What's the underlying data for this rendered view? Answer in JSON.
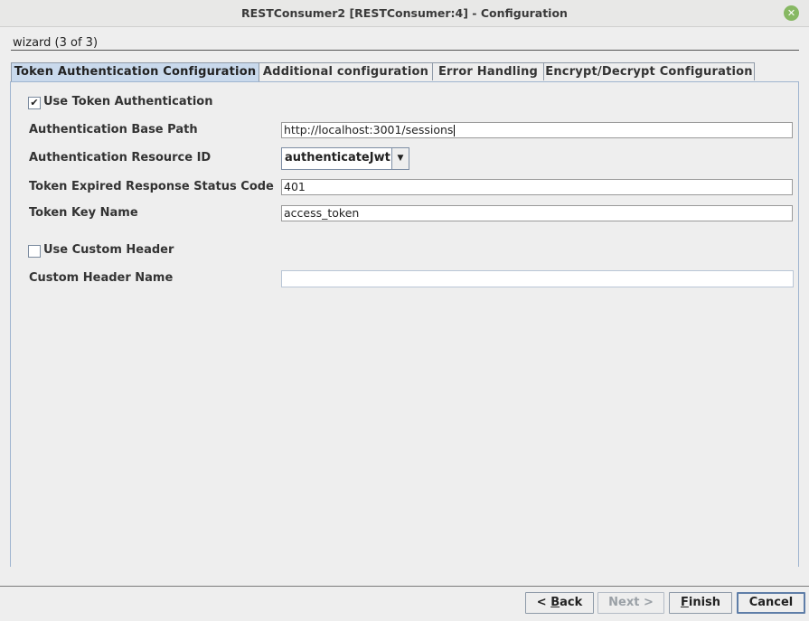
{
  "window": {
    "title": "RESTConsumer2 [RESTConsumer:4] - Configuration"
  },
  "wizard": {
    "label": "wizard (3 of 3)"
  },
  "tabs": [
    {
      "label": "Token Authentication Configuration",
      "active": true
    },
    {
      "label": "Additional configuration",
      "active": false
    },
    {
      "label": "Error Handling",
      "active": false
    },
    {
      "label": "Encrypt/Decrypt Configuration",
      "active": false
    }
  ],
  "form": {
    "use_token_auth": {
      "label": "Use Token Authentication",
      "checked": true,
      "mark": "✔"
    },
    "auth_base_path": {
      "label": "Authentication Base Path",
      "value": "http://localhost:3001/sessions"
    },
    "auth_resource_id": {
      "label": "Authentication Resource ID",
      "value": "authenticateJwt"
    },
    "token_expired_code": {
      "label": "Token Expired Response Status Code",
      "value": "401"
    },
    "token_key_name": {
      "label": "Token Key Name",
      "value": "access_token"
    },
    "use_custom_header": {
      "label": "Use Custom Header",
      "checked": false
    },
    "custom_header_name": {
      "label": "Custom Header Name",
      "value": ""
    }
  },
  "buttons": {
    "back": {
      "prefix": "< ",
      "mnemonic": "B",
      "rest": "ack"
    },
    "next": {
      "label": "Next >",
      "enabled": false
    },
    "finish": {
      "mnemonic": "F",
      "rest": "inish"
    },
    "cancel": {
      "label": "Cancel"
    }
  },
  "colors": {
    "active_tab": "#c9d9ec",
    "close_button": "#87b863",
    "panel_border": "#9fb4cf"
  }
}
